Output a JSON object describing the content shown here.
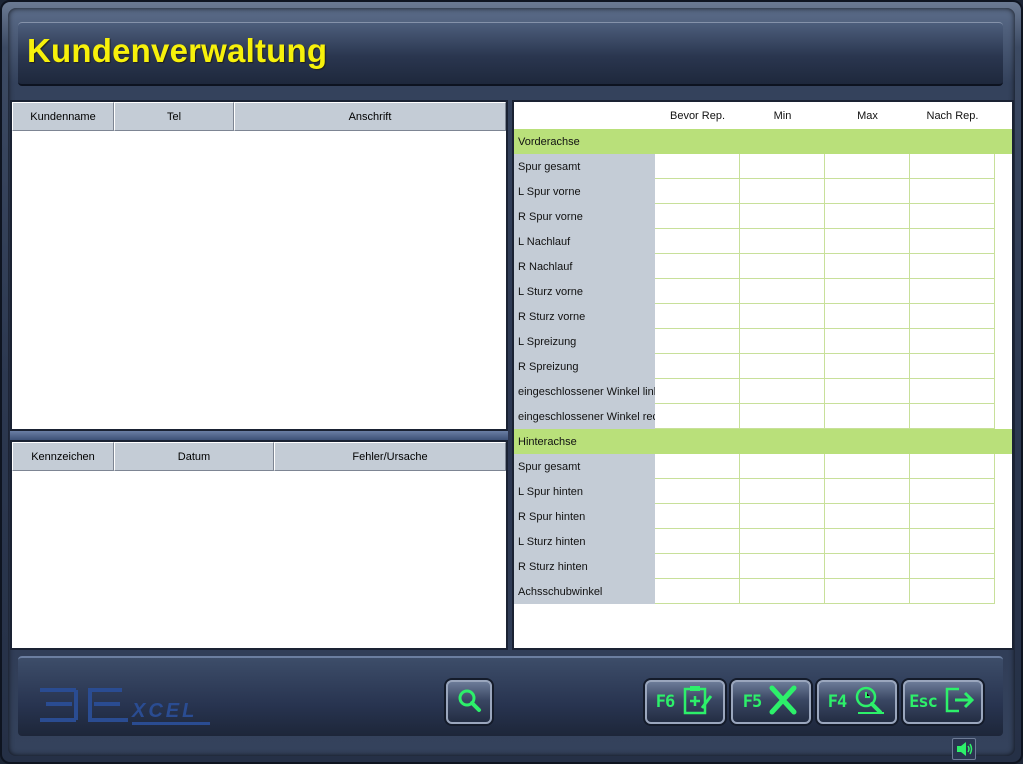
{
  "window": {
    "title": "Kundenverwaltung"
  },
  "customers": {
    "columns": [
      "Kundenname",
      "Tel",
      "Anschrift"
    ]
  },
  "records": {
    "columns": [
      "Kennzeichen",
      "Datum",
      "Fehler/Ursache"
    ]
  },
  "measurements": {
    "columns": [
      "Bevor Rep.",
      "Min",
      "Max",
      "Nach Rep."
    ],
    "sections": [
      {
        "name": "Vorderachse",
        "rows": [
          "Spur gesamt",
          "L Spur vorne",
          "R Spur vorne",
          "L Nachlauf",
          "R Nachlauf",
          "L Sturz vorne",
          "R Sturz vorne",
          "L Spreizung",
          "R Spreizung",
          "eingeschlossener Winkel links",
          "eingeschlossener Winkel rechts"
        ]
      },
      {
        "name": "Hinterachse",
        "rows": [
          "Spur gesamt",
          "L Spur hinten",
          "R Spur hinten",
          "L Sturz hinten",
          "R Sturz hinten",
          "Achsschubwinkel"
        ]
      }
    ]
  },
  "logo": {
    "text": "XCEL",
    "name": "Excel"
  },
  "toolbar": {
    "search_icon": "magnifier-icon",
    "buttons": [
      {
        "key": "F6",
        "icon": "clipboard-add-icon"
      },
      {
        "key": "F5",
        "icon": "delete-x-icon"
      },
      {
        "key": "F4",
        "icon": "magnify-time-icon"
      },
      {
        "key": "Esc",
        "icon": "exit-icon"
      }
    ]
  },
  "colors": {
    "title": "#f7f10b",
    "section_row": "#b9e07a",
    "label_cell": "#c4ccd6",
    "key_text": "#2df06a"
  }
}
